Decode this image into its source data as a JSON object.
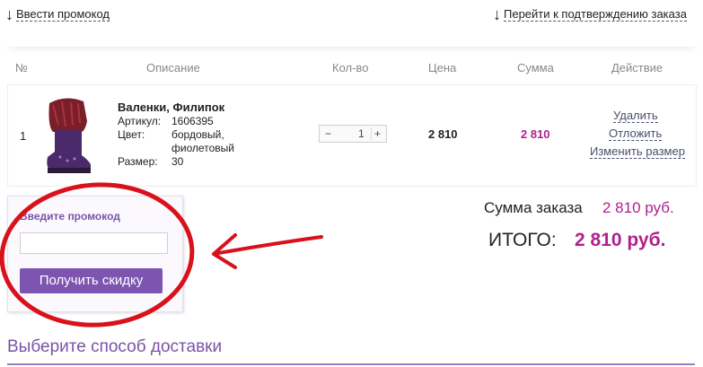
{
  "nav": {
    "promo_link": "Ввести промокод",
    "confirm_link": "Перейти к подтверждению заказа"
  },
  "table": {
    "headers": [
      "№",
      "Описание",
      "Кол-во",
      "Цена",
      "Сумма",
      "Действие"
    ]
  },
  "item": {
    "number": "1",
    "name": "Валенки, Филипок",
    "article_label": "Артикул:",
    "article": "1606395",
    "color_label": "Цвет:",
    "color_line1": "бордовый,",
    "color_line2": "фиолетовый",
    "size_label": "Размер:",
    "size": "30",
    "quantity": "1",
    "minus": "−",
    "plus": "+",
    "price": "2 810",
    "sum": "2 810",
    "actions": [
      "Удалить",
      "Отложить",
      "Изменить размер"
    ]
  },
  "promo": {
    "title": "Введите промокод",
    "input_value": "",
    "button": "Получить скидку"
  },
  "totals": {
    "sum_label": "Сумма заказа",
    "sum_value": "2 810 руб.",
    "total_label": "ИТОГО:",
    "total_value": "2 810 руб."
  },
  "delivery": {
    "title": "Выберите способ доставки"
  },
  "colors": {
    "accent": "#7d55b1",
    "price_highlight": "#b0208c",
    "annotation": "#d8111b"
  }
}
